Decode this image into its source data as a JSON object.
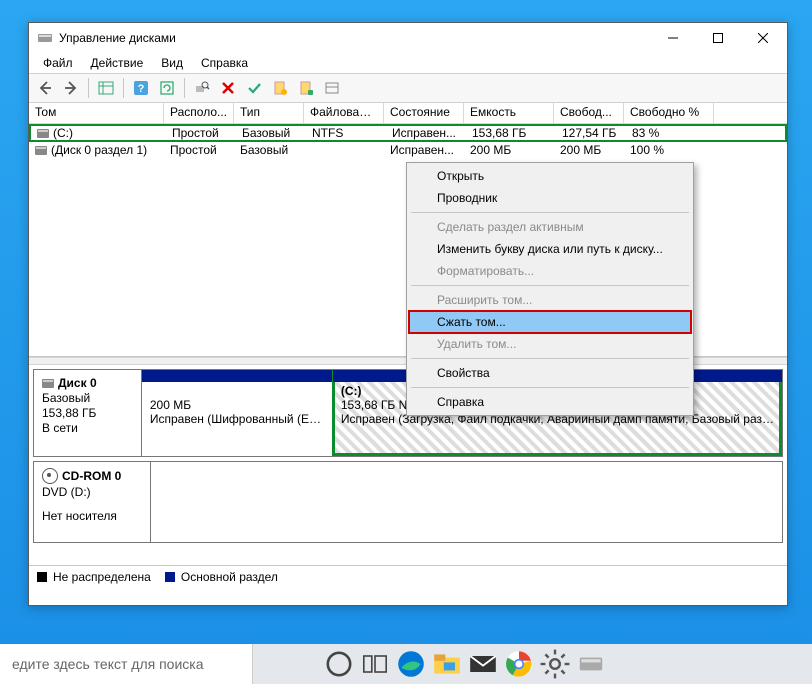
{
  "titlebar": {
    "title": "Управление дисками"
  },
  "menubar": {
    "file": "Файл",
    "action": "Действие",
    "view": "Вид",
    "help": "Справка"
  },
  "table": {
    "headers": {
      "vol": "Том",
      "loc": "Располо...",
      "type": "Тип",
      "fs": "Файловая с...",
      "state": "Состояние",
      "cap": "Емкость",
      "free": "Свобод...",
      "pct": "Свободно %"
    },
    "rows": [
      {
        "vol": "(C:)",
        "loc": "Простой",
        "type": "Базовый",
        "fs": "NTFS",
        "state": "Исправен...",
        "cap": "153,68 ГБ",
        "free": "127,54 ГБ",
        "pct": "83 %",
        "hl": true
      },
      {
        "vol": "(Диск 0 раздел 1)",
        "loc": "Простой",
        "type": "Базовый",
        "fs": "",
        "state": "Исправен...",
        "cap": "200 МБ",
        "free": "200 МБ",
        "pct": "100 %",
        "hl": false
      }
    ]
  },
  "context_menu": {
    "open": "Открыть",
    "explorer": "Проводник",
    "make_active": "Сделать раздел активным",
    "change_letter": "Изменить букву диска или путь к диску...",
    "format": "Форматировать...",
    "extend": "Расширить том...",
    "shrink": "Сжать том...",
    "delete": "Удалить том...",
    "properties": "Свойства",
    "help": "Справка"
  },
  "disks": {
    "disk0": {
      "name": "Диск 0",
      "type": "Базовый",
      "size": "153,88 ГБ",
      "status": "В сети",
      "part1": {
        "size": "200 МБ",
        "status": "Исправен (Шифрованный (EFI) …"
      },
      "part2": {
        "label": "(C:)",
        "size": "153,68 ГБ N…",
        "status": "Исправен (Загрузка, Файл подкачки, Аварийный дамп памяти, Базовый раз…"
      }
    },
    "cdrom": {
      "name": "CD-ROM 0",
      "type": "DVD (D:)",
      "status": "Нет носителя"
    }
  },
  "legend": {
    "unallocated": "Не распределена",
    "primary": "Основной раздел"
  },
  "taskbar": {
    "search_placeholder": "едите здесь текст для поиска"
  }
}
